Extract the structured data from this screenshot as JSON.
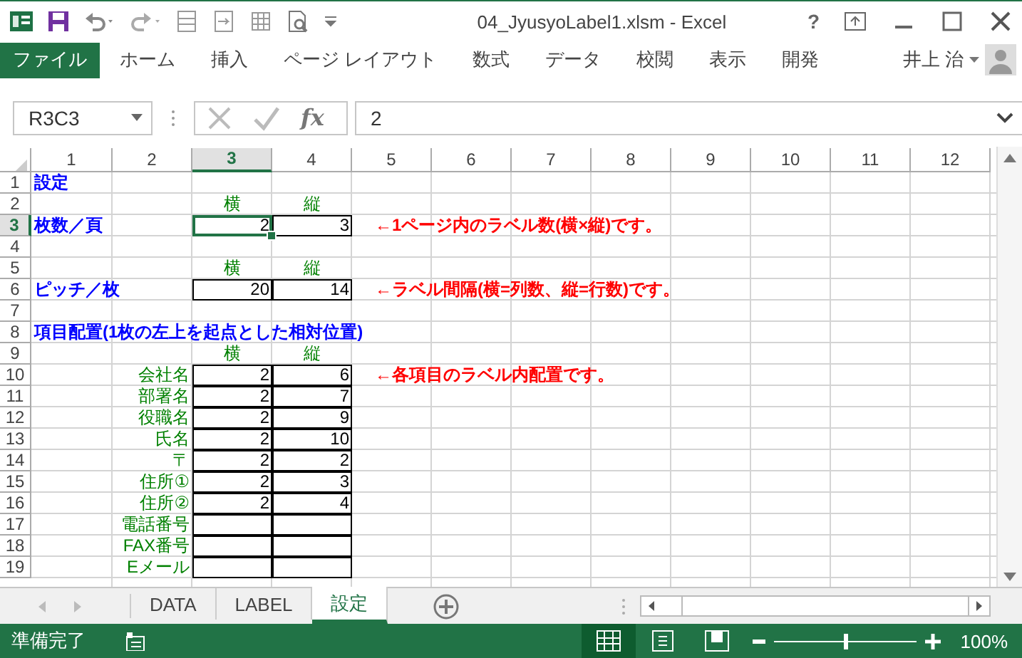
{
  "window": {
    "title": "04_JyusyoLabel1.xlsm - Excel",
    "help": "?"
  },
  "ribbon": {
    "tabs": [
      {
        "label": "ファイル",
        "selected": true
      },
      {
        "label": "ホーム",
        "selected": false
      },
      {
        "label": "挿入",
        "selected": false
      },
      {
        "label": "ページ レイアウト",
        "selected": false
      },
      {
        "label": "数式",
        "selected": false
      },
      {
        "label": "データ",
        "selected": false
      },
      {
        "label": "校閲",
        "selected": false
      },
      {
        "label": "表示",
        "selected": false
      },
      {
        "label": "開発",
        "selected": false
      }
    ],
    "user": "井上 治"
  },
  "formula_bar": {
    "name_box": "R3C3",
    "function_label": "fx",
    "value": "2"
  },
  "sheet": {
    "columns": [
      {
        "label": "1",
        "selected": false
      },
      {
        "label": "2",
        "selected": false
      },
      {
        "label": "3",
        "selected": true
      },
      {
        "label": "4",
        "selected": false
      },
      {
        "label": "5",
        "selected": false
      },
      {
        "label": "6",
        "selected": false
      },
      {
        "label": "7",
        "selected": false
      },
      {
        "label": "8",
        "selected": false
      },
      {
        "label": "9",
        "selected": false
      },
      {
        "label": "10",
        "selected": false
      },
      {
        "label": "11",
        "selected": false
      },
      {
        "label": "12",
        "selected": false
      }
    ],
    "rows": [
      {
        "header": "1",
        "selected": false,
        "cells": [
          {
            "kind": "heading",
            "text": "設定"
          }
        ]
      },
      {
        "header": "2",
        "selected": false,
        "cells": [
          {},
          {},
          {
            "kind": "column_label",
            "text": "横"
          },
          {
            "kind": "column_label",
            "text": "縦"
          }
        ]
      },
      {
        "header": "3",
        "selected": true,
        "cells": [
          {
            "kind": "heading",
            "text": "枚数／頁"
          },
          {},
          {
            "kind": "value",
            "text": "2",
            "selected": true
          },
          {
            "kind": "value",
            "text": "3",
            "selected": false
          },
          {
            "kind": "note",
            "text": "←1ページ内のラベル数(横×縦)です。"
          }
        ]
      },
      {
        "header": "4",
        "selected": false,
        "cells": []
      },
      {
        "header": "5",
        "selected": false,
        "cells": [
          {},
          {},
          {
            "kind": "column_label",
            "text": "横"
          },
          {
            "kind": "column_label",
            "text": "縦"
          }
        ]
      },
      {
        "header": "6",
        "selected": false,
        "cells": [
          {
            "kind": "heading",
            "text": "ピッチ／枚"
          },
          {},
          {
            "kind": "value",
            "text": "20",
            "selected": false
          },
          {
            "kind": "value",
            "text": "14",
            "selected": false
          },
          {
            "kind": "note",
            "text": "←ラベル間隔(横=列数、縦=行数)です。"
          }
        ]
      },
      {
        "header": "7",
        "selected": false,
        "cells": []
      },
      {
        "header": "8",
        "selected": false,
        "cells": [
          {
            "kind": "heading",
            "text": "項目配置(1枚の左上を起点とした相対位置)"
          }
        ]
      },
      {
        "header": "9",
        "selected": false,
        "cells": [
          {},
          {},
          {
            "kind": "column_label",
            "text": "横"
          },
          {
            "kind": "column_label",
            "text": "縦"
          }
        ]
      },
      {
        "header": "10",
        "selected": false,
        "cells": [
          {},
          {
            "kind": "item_label",
            "text": "会社名"
          },
          {
            "kind": "value",
            "text": "2",
            "selected": false
          },
          {
            "kind": "value",
            "text": "6",
            "selected": false
          },
          {
            "kind": "note",
            "text": "←各項目のラベル内配置です。"
          }
        ]
      },
      {
        "header": "11",
        "selected": false,
        "cells": [
          {},
          {
            "kind": "item_label",
            "text": "部署名"
          },
          {
            "kind": "value",
            "text": "2",
            "selected": false
          },
          {
            "kind": "value",
            "text": "7",
            "selected": false
          }
        ]
      },
      {
        "header": "12",
        "selected": false,
        "cells": [
          {},
          {
            "kind": "item_label",
            "text": "役職名"
          },
          {
            "kind": "value",
            "text": "2",
            "selected": false
          },
          {
            "kind": "value",
            "text": "9",
            "selected": false
          }
        ]
      },
      {
        "header": "13",
        "selected": false,
        "cells": [
          {},
          {
            "kind": "item_label",
            "text": "氏名"
          },
          {
            "kind": "value",
            "text": "2",
            "selected": false
          },
          {
            "kind": "value",
            "text": "10",
            "selected": false
          }
        ]
      },
      {
        "header": "14",
        "selected": false,
        "cells": [
          {},
          {
            "kind": "item_label",
            "text": "〒"
          },
          {
            "kind": "value",
            "text": "2",
            "selected": false
          },
          {
            "kind": "value",
            "text": "2",
            "selected": false
          }
        ]
      },
      {
        "header": "15",
        "selected": false,
        "cells": [
          {},
          {
            "kind": "item_label",
            "text": "住所①"
          },
          {
            "kind": "value",
            "text": "2",
            "selected": false
          },
          {
            "kind": "value",
            "text": "3",
            "selected": false
          }
        ]
      },
      {
        "header": "16",
        "selected": false,
        "cells": [
          {},
          {
            "kind": "item_label",
            "text": "住所②"
          },
          {
            "kind": "value",
            "text": "2",
            "selected": false
          },
          {
            "kind": "value",
            "text": "4",
            "selected": false
          }
        ]
      },
      {
        "header": "17",
        "selected": false,
        "cells": [
          {},
          {
            "kind": "item_label",
            "text": "電話番号"
          },
          {
            "kind": "value",
            "selected": false
          },
          {
            "kind": "value",
            "selected": false
          }
        ]
      },
      {
        "header": "18",
        "selected": false,
        "cells": [
          {},
          {
            "kind": "item_label",
            "text": "FAX番号"
          },
          {
            "kind": "value",
            "selected": false
          },
          {
            "kind": "value",
            "selected": false
          }
        ]
      },
      {
        "header": "19",
        "selected": false,
        "cells": [
          {},
          {
            "kind": "item_label",
            "text": "Eメール"
          },
          {
            "kind": "value",
            "selected": false
          },
          {
            "kind": "value",
            "selected": false
          }
        ]
      }
    ]
  },
  "sheet_tabs": [
    {
      "label": "DATA",
      "selected": false
    },
    {
      "label": "LABEL",
      "selected": false
    },
    {
      "label": "設定",
      "selected": true
    }
  ],
  "status_bar": {
    "status": "準備完了",
    "views": [
      {
        "kind": "normal",
        "selected": true
      },
      {
        "kind": "page_layout",
        "selected": false
      },
      {
        "kind": "page_break",
        "selected": false
      }
    ],
    "zoom": {
      "level": 0.5,
      "reading": "100%"
    }
  }
}
